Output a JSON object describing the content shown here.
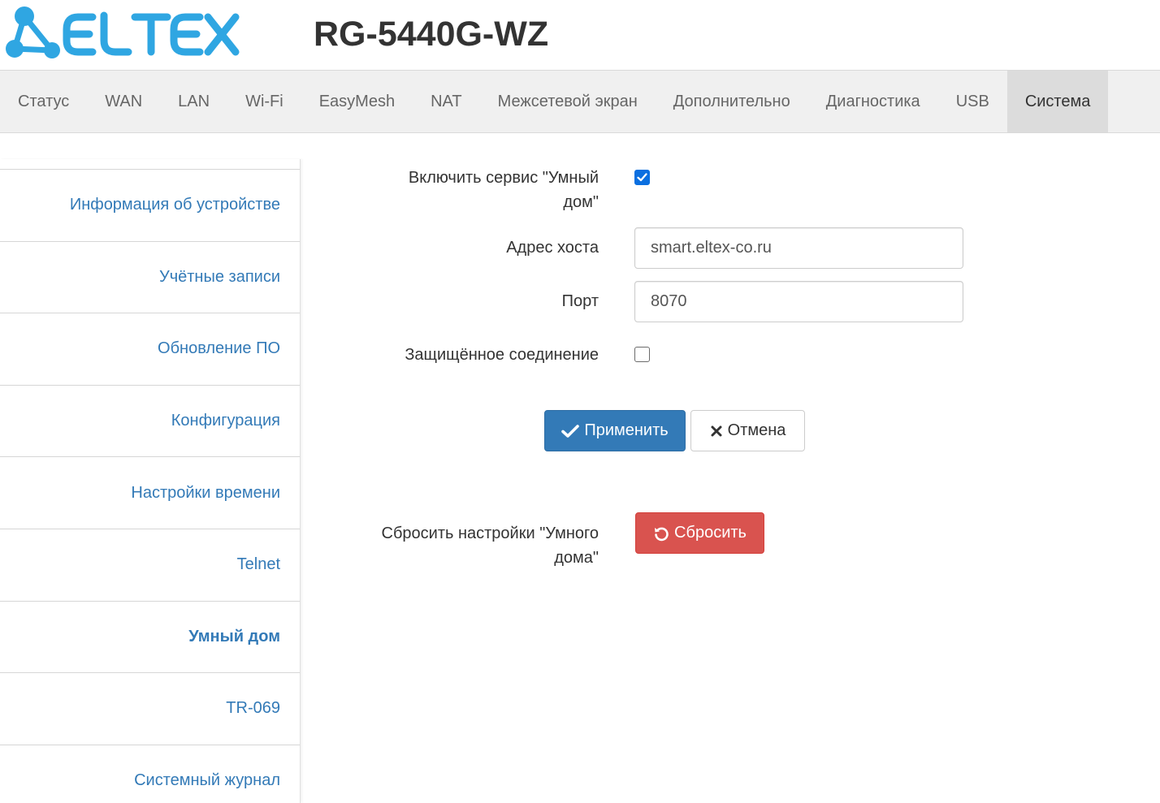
{
  "header": {
    "logo_text": "ELTEX",
    "model": "RG-5440G-WZ"
  },
  "topnav": {
    "tabs": [
      {
        "label": "Статус"
      },
      {
        "label": "WAN"
      },
      {
        "label": "LAN"
      },
      {
        "label": "Wi-Fi"
      },
      {
        "label": "EasyMesh"
      },
      {
        "label": "NAT"
      },
      {
        "label": "Межсетевой экран"
      },
      {
        "label": "Дополнительно"
      },
      {
        "label": "Диагностика"
      },
      {
        "label": "USB"
      },
      {
        "label": "Система",
        "active": true
      }
    ]
  },
  "sidebar": {
    "items": [
      {
        "label": "Информация об устройстве"
      },
      {
        "label": "Учётные записи"
      },
      {
        "label": "Обновление ПО"
      },
      {
        "label": "Конфигурация"
      },
      {
        "label": "Настройки времени"
      },
      {
        "label": "Telnet"
      },
      {
        "label": "Умный дом",
        "active": true
      },
      {
        "label": "TR-069"
      },
      {
        "label": "Системный журнал"
      }
    ]
  },
  "form": {
    "enable_label_line1": "Включить сервис \"Умный",
    "enable_label_line2": "дом\"",
    "enable_checked": true,
    "host_label": "Адрес хоста",
    "host_value": "smart.eltex-co.ru",
    "port_label": "Порт",
    "port_value": "8070",
    "secure_label": "Защищённое соединение",
    "secure_checked": false,
    "apply_label": "Применить",
    "cancel_label": "Отмена",
    "reset_label_line1": "Сбросить настройки \"Умного",
    "reset_label_line2": "дома\"",
    "reset_button_label": "Сбросить"
  },
  "colors": {
    "brand": "#2fa6e2",
    "link": "#337ab7",
    "primary": "#337ab7",
    "danger": "#d9534f",
    "checkbox_checked": "#0b6fe0"
  },
  "icons": {
    "apply": "check-icon",
    "cancel": "close-icon",
    "reset": "undo-icon"
  }
}
